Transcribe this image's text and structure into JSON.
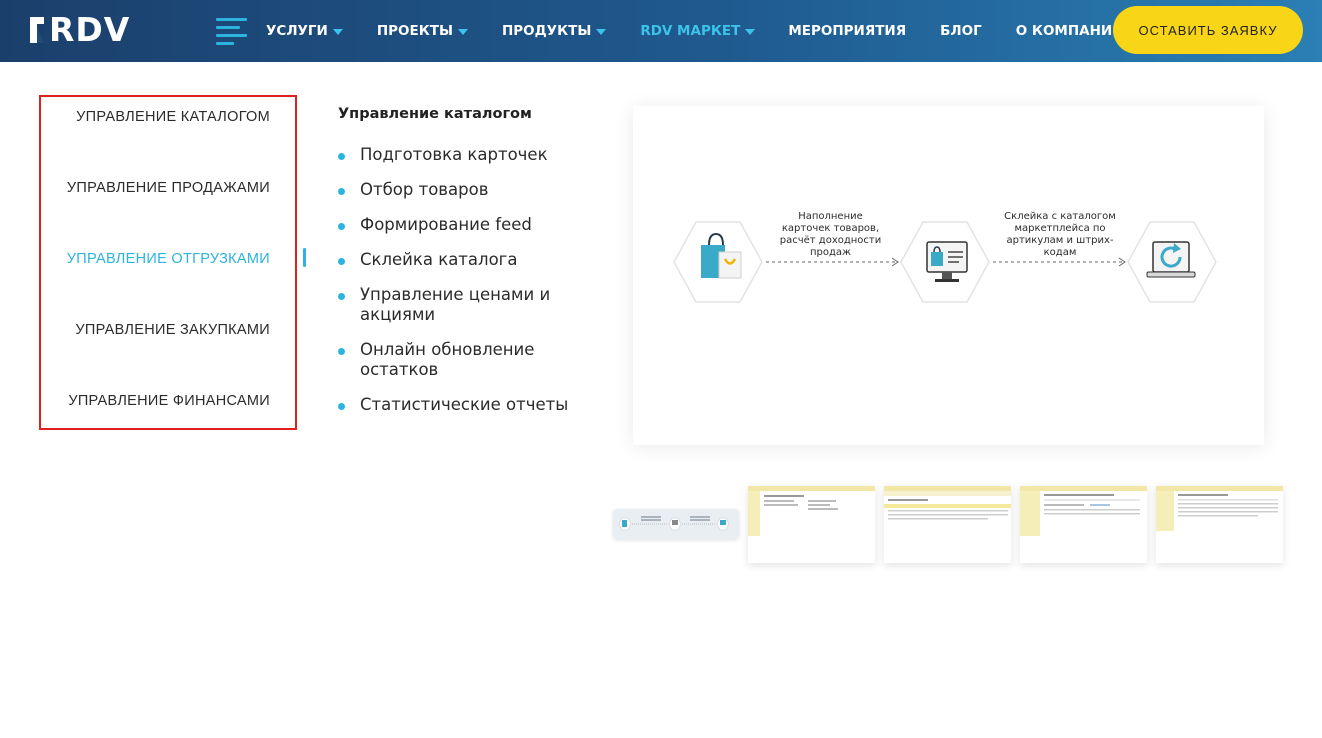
{
  "header": {
    "logo_text": "RDV",
    "nav": [
      {
        "label": "УСЛУГИ",
        "dropdown": true,
        "active": false
      },
      {
        "label": "ПРОЕКТЫ",
        "dropdown": true,
        "active": false
      },
      {
        "label": "ПРОДУКТЫ",
        "dropdown": true,
        "active": false
      },
      {
        "label": "RDV МАРКЕТ",
        "dropdown": true,
        "active": true
      },
      {
        "label": "МЕРОПРИЯТИЯ",
        "dropdown": false,
        "active": false
      },
      {
        "label": "БЛОГ",
        "dropdown": false,
        "active": false
      },
      {
        "label": "О КОМПАНИИ",
        "dropdown": true,
        "active": false
      }
    ],
    "cta_label": "ОСТАВИТЬ ЗАЯВКУ"
  },
  "categories": [
    {
      "label": "УПРАВЛЕНИЕ КАТАЛОГОМ",
      "active": false
    },
    {
      "label": "УПРАВЛЕНИЕ ПРОДАЖАМИ",
      "active": false
    },
    {
      "label": "УПРАВЛЕНИЕ ОТГРУЗКАМИ",
      "active": true
    },
    {
      "label": "УПРАВЛЕНИЕ ЗАКУПКАМИ",
      "active": false
    },
    {
      "label": "УПРАВЛЕНИЕ ФИНАНСАМИ",
      "active": false
    }
  ],
  "section": {
    "title": "Управление каталогом",
    "features": [
      "Подготовка карточек",
      "Отбор товаров",
      "Формирование feed",
      "Склейка каталога",
      "Управление ценами и акциями",
      "Онлайн обновление остатков",
      "Статистические отчеты"
    ]
  },
  "diagram": {
    "label1": "Наполнение карточек товаров, расчёт доходности продаж",
    "label2": "Склейка с каталогом маркетплейса по артикулам и штрих-кодам"
  },
  "colors": {
    "accent": "#2ab4de",
    "cta": "#f8d516",
    "highlight_border": "#e01f1f",
    "header_dark": "#1b3f6b",
    "header_light": "#2a7fb4"
  },
  "icons": [
    "menu-icon",
    "caret-down-icon",
    "shopping-bag-icon",
    "monitor-cart-icon",
    "laptop-refresh-icon"
  ]
}
